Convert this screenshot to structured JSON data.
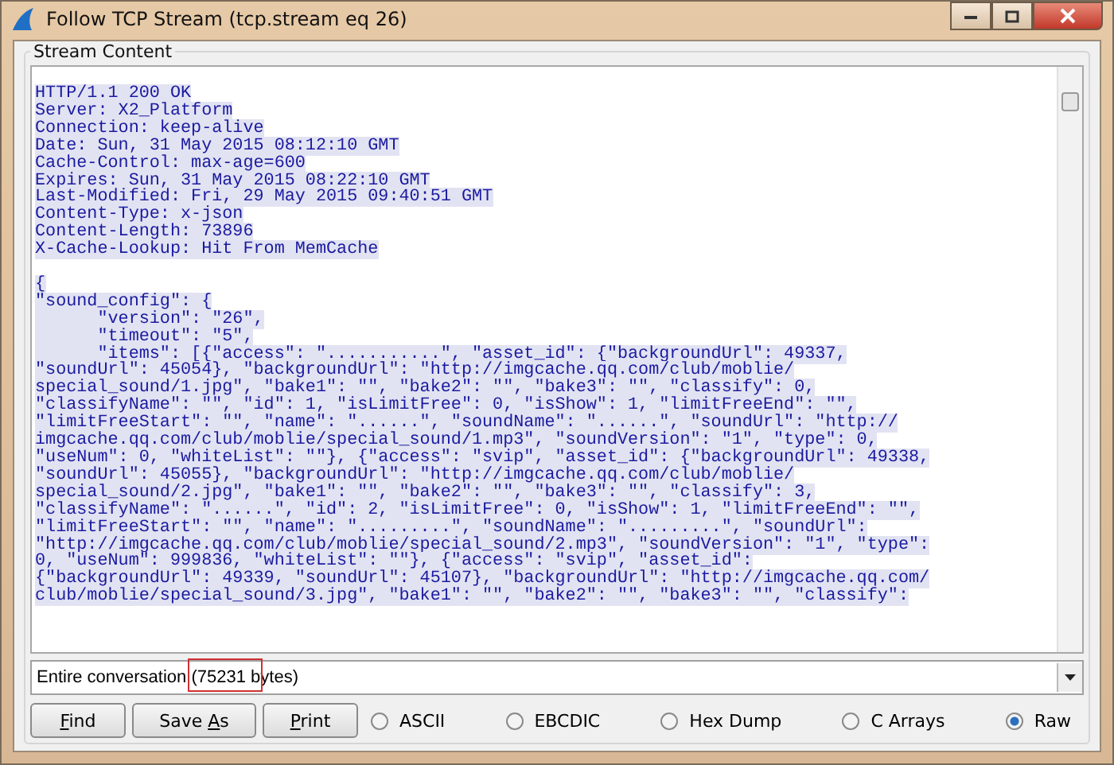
{
  "window": {
    "title": "Follow TCP Stream (tcp.stream eq 26)"
  },
  "stream_content": {
    "title": "Stream Content",
    "header_lines": [
      "HTTP/1.1 200 OK",
      "Server: X2_Platform",
      "Connection: keep-alive",
      "Date: Sun, 31 May 2015 08:12:10 GMT",
      "Cache-Control: max-age=600",
      "Expires: Sun, 31 May 2015 08:22:10 GMT",
      "Last-Modified: Fri, 29 May 2015 09:40:51 GMT",
      "Content-Type: x-json",
      "Content-Length: 73896",
      "X-Cache-Lookup: Hit From MemCache"
    ],
    "body_lines": [
      "{",
      "\"sound_config\": {",
      "      \"version\": \"26\",",
      "      \"timeout\": \"5\",",
      "      \"items\": [{\"access\": \"...........\", \"asset_id\": {\"backgroundUrl\": 49337,",
      "\"soundUrl\": 45054}, \"backgroundUrl\": \"http://imgcache.qq.com/club/moblie/",
      "special_sound/1.jpg\", \"bake1\": \"\", \"bake2\": \"\", \"bake3\": \"\", \"classify\": 0,",
      "\"classifyName\": \"\", \"id\": 1, \"isLimitFree\": 0, \"isShow\": 1, \"limitFreeEnd\": \"\",",
      "\"limitFreeStart\": \"\", \"name\": \"......\", \"soundName\": \"......\", \"soundUrl\": \"http://",
      "imgcache.qq.com/club/moblie/special_sound/1.mp3\", \"soundVersion\": \"1\", \"type\": 0,",
      "\"useNum\": 0, \"whiteList\": \"\"}, {\"access\": \"svip\", \"asset_id\": {\"backgroundUrl\": 49338,",
      "\"soundUrl\": 45055}, \"backgroundUrl\": \"http://imgcache.qq.com/club/moblie/",
      "special_sound/2.jpg\", \"bake1\": \"\", \"bake2\": \"\", \"bake3\": \"\", \"classify\": 3,",
      "\"classifyName\": \"......\", \"id\": 2, \"isLimitFree\": 0, \"isShow\": 1, \"limitFreeEnd\": \"\",",
      "\"limitFreeStart\": \"\", \"name\": \".........\", \"soundName\": \".........\", \"soundUrl\":",
      "\"http://imgcache.qq.com/club/moblie/special_sound/2.mp3\", \"soundVersion\": \"1\", \"type\":",
      "0, \"useNum\": 999836, \"whiteList\": \"\"}, {\"access\": \"svip\", \"asset_id\":",
      "{\"backgroundUrl\": 49339, \"soundUrl\": 45107}, \"backgroundUrl\": \"http://imgcache.qq.com/",
      "club/moblie/special_sound/3.jpg\", \"bake1\": \"\", \"bake2\": \"\", \"bake3\": \"\", \"classify\":"
    ]
  },
  "conversation_select": {
    "value": "Entire conversation (75231 bytes)"
  },
  "buttons": [
    {
      "mnemonic": "F",
      "after": "ind"
    },
    {
      "before": "Save ",
      "mnemonic": "A",
      "after": "s"
    },
    {
      "mnemonic": "P",
      "after": "rint"
    }
  ],
  "format_options": [
    {
      "label": "ASCII",
      "selected": false
    },
    {
      "label": "EBCDIC",
      "selected": false
    },
    {
      "label": "Hex Dump",
      "selected": false
    },
    {
      "label": "C Arrays",
      "selected": false
    },
    {
      "label": "Raw",
      "selected": true
    }
  ]
}
